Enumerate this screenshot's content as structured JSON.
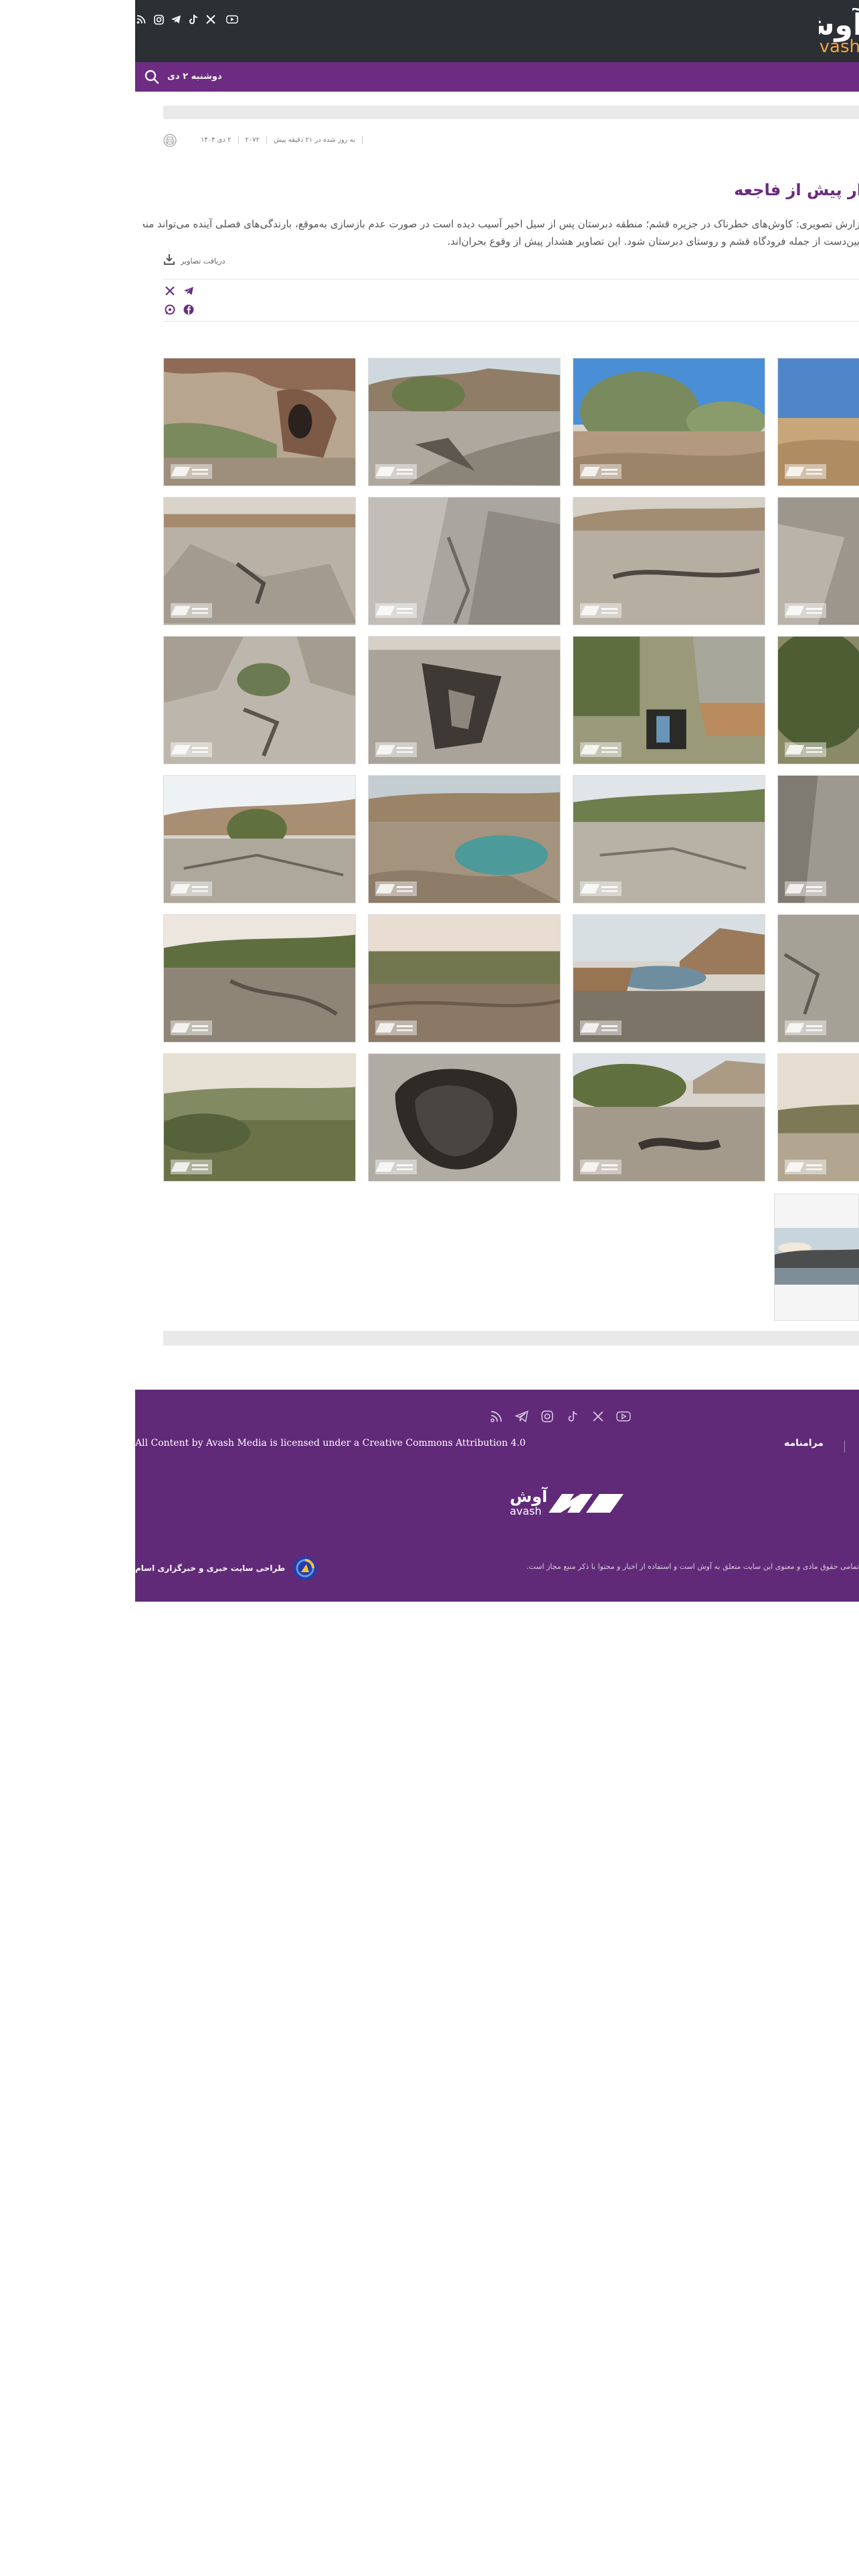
{
  "header": {
    "logo_fa": "آوش",
    "logo_en": "avash",
    "social_icons": [
      "youtube-icon",
      "x-icon",
      "tiktok-icon",
      "telegram-icon",
      "instagram-icon",
      "rss-icon"
    ],
    "date": "دوشنبه ۲ دی"
  },
  "article": {
    "meta": {
      "date": "۲ دی ۱۴۰۴",
      "code": "۲۰۷۲",
      "updated": "به روز شده در ۲۱ دقیقه پیش"
    },
    "title": "هشدار پیش از فاجعه",
    "lead_line1": "گزارش تصویری: کاوش‌های خطرناک در جزیره قشم؛ منطقه دبرستان پس از سیل اخیر آسیب دیده است در صورت عدم بازسازی به‌موقع، بارندگی‌های فصلی آینده می‌تواند منجر به شکست سد و بروز فاجعه، برای مناطق",
    "lead_line2": "پایین‌دست از جمله فرودگاه قشم و روستای دبرستان شود. این تصاویر هشدار پیش از وقوع بحران‌اند.",
    "download_label": "دریافت تصاویر"
  },
  "share": {
    "icons": [
      "telegram-icon",
      "x-icon",
      "facebook-icon",
      "whatsapp-icon"
    ]
  },
  "footer": {
    "social_icons": [
      "youtube-icon",
      "x-icon",
      "tiktok-icon",
      "instagram-icon",
      "telegram-icon",
      "rss-icon"
    ],
    "license": "All Content by Avash Media is licensed under a Creative Commons Attribution 4.0",
    "terms": "مرامنامه",
    "logo_fa": "آوش",
    "logo_en": "avash",
    "copyright": "تمامی حقوق مادی و معنوی این سایت متعلق به آوش است و استفاده از اخبار و محتوا با ذکر منبع مجاز است.",
    "designer": "طراحی سایت خبری و خبرگزاری اسام"
  },
  "colors": {
    "topbar": "#2c2f34",
    "navbar": "#6d2b82",
    "title": "#6a2a7e",
    "footer": "#612a78",
    "accent_logo": "#f2a541"
  }
}
